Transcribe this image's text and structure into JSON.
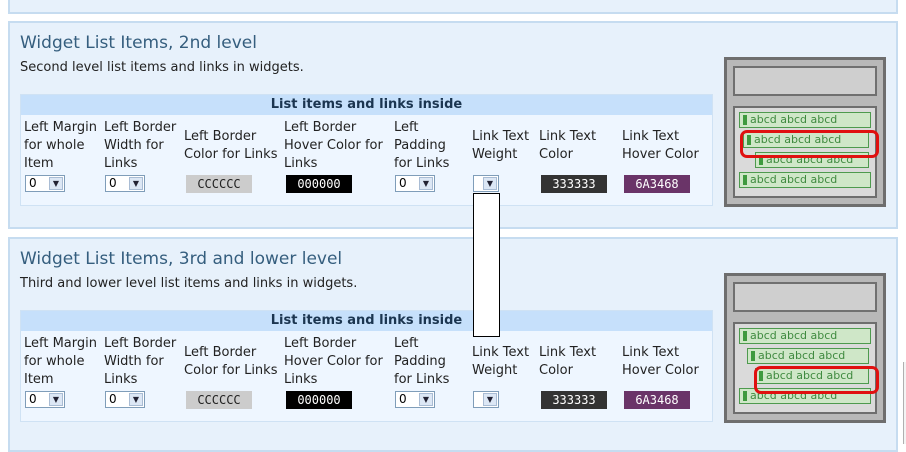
{
  "sections": [
    {
      "title": "Widget List Items, 2nd level",
      "description": "Second level list items and links in widgets.",
      "table_header": "List items and links inside",
      "columns": [
        {
          "label": "Left Margin for whole Item",
          "control": "select",
          "value": "0"
        },
        {
          "label": "Left Border Width for Links",
          "control": "select",
          "value": "0"
        },
        {
          "label": "Left Border Color for Links",
          "control": "color",
          "value": "CCCCCC",
          "bg": "#cccccc",
          "fg": "#222222"
        },
        {
          "label": "Left Border Hover Color for Links",
          "control": "color",
          "value": "000000",
          "bg": "#000000",
          "fg": "#ffffff"
        },
        {
          "label": "Left Padding for Links",
          "control": "select",
          "value": "0"
        },
        {
          "label": "Link Text Weight",
          "control": "select",
          "value": ""
        },
        {
          "label": "Link Text Color",
          "control": "color",
          "value": "333333",
          "bg": "#333333",
          "fg": "#ffffff"
        },
        {
          "label": "Link Text Hover Color",
          "control": "color",
          "value": "6A3468",
          "bg": "#6a3468",
          "fg": "#ffffff"
        }
      ],
      "preview_items": [
        "abcd abcd abcd",
        "abcd abcd abcd",
        "abcd abcd abcd",
        "abcd abcd abcd"
      ]
    },
    {
      "title": "Widget List Items, 3rd and lower level",
      "description": "Third and lower level list items and links in widgets.",
      "table_header": "List items and links inside",
      "columns": [
        {
          "label": "Left Margin for whole Item",
          "control": "select",
          "value": "0"
        },
        {
          "label": "Left Border Width for Links",
          "control": "select",
          "value": "0"
        },
        {
          "label": "Left Border Color for Links",
          "control": "color",
          "value": "CCCCCC",
          "bg": "#cccccc",
          "fg": "#222222"
        },
        {
          "label": "Left Border Hover Color for Links",
          "control": "color",
          "value": "000000",
          "bg": "#000000",
          "fg": "#ffffff"
        },
        {
          "label": "Left Padding for Links",
          "control": "select",
          "value": "0"
        },
        {
          "label": "Link Text Weight",
          "control": "select",
          "value": ""
        },
        {
          "label": "Link Text Color",
          "control": "color",
          "value": "333333",
          "bg": "#333333",
          "fg": "#ffffff"
        },
        {
          "label": "Link Text Hover Color",
          "control": "color",
          "value": "6A3468",
          "bg": "#6a3468",
          "fg": "#ffffff"
        }
      ],
      "preview_items": [
        "abcd abcd abcd",
        "abcd abcd abcd",
        "abcd abcd abcd",
        "abcd abcd abcd"
      ]
    }
  ],
  "icons": {
    "select_arrow": "chevron-down-icon"
  },
  "colors": {
    "panel_bg": "#e7f1fb",
    "title": "#355e7e",
    "highlight": "#e01010",
    "preview_link": "#3f8a3f"
  }
}
